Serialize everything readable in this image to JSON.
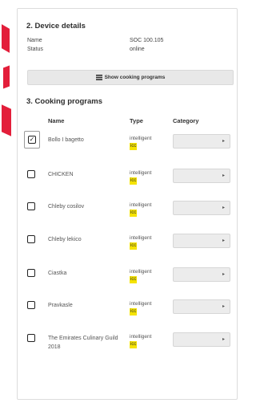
{
  "device": {
    "heading": "2. Device details",
    "name_label": "Name",
    "name_value": "SOC 100.105",
    "status_label": "Status",
    "status_value": "online",
    "show_button": "Show cooking programs"
  },
  "programs": {
    "heading": "3. Cooking programs",
    "columns": [
      "Name",
      "Type",
      "Category"
    ],
    "rows": [
      {
        "name": "Bollo I bagetto",
        "type": "intelligent",
        "tag": "icc",
        "checked": true
      },
      {
        "name": "CHICKEN",
        "type": "intelligent",
        "tag": "icc",
        "checked": false
      },
      {
        "name": "Chleby cosilov",
        "type": "intelligent",
        "tag": "icc",
        "checked": false
      },
      {
        "name": "Chleby lekico",
        "type": "intelligent",
        "tag": "icc",
        "checked": false
      },
      {
        "name": "Ciastka",
        "type": "intelligent",
        "tag": "icc",
        "checked": false
      },
      {
        "name": "Pravkasle",
        "type": "intelligent",
        "tag": "icc",
        "checked": false
      },
      {
        "name": "The Emirates Culinary Guild 2018",
        "type": "intelligent",
        "tag": "icc",
        "checked": false
      }
    ]
  },
  "colors": {
    "accent_red": "#e31e3a",
    "tag_yellow": "#f5e300"
  }
}
